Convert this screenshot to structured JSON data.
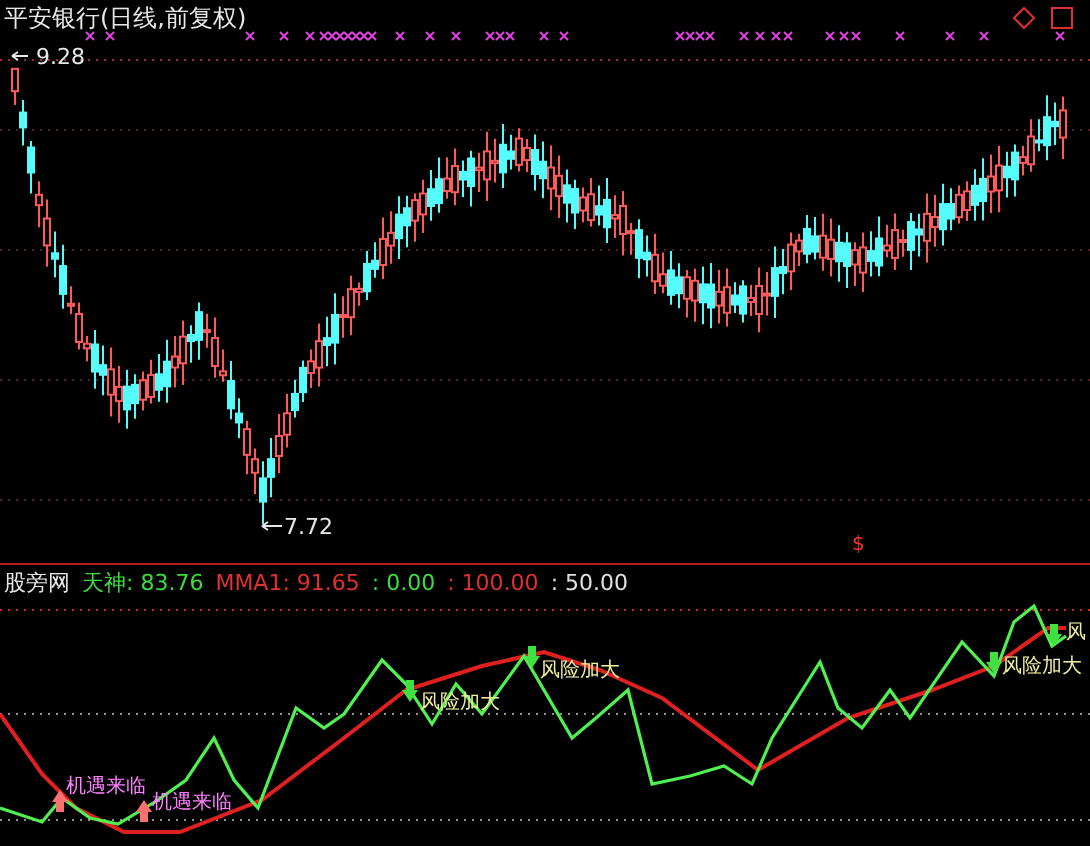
{
  "main_chart": {
    "title": "平安银行(日线,前复权)",
    "high_label": "9.28",
    "low_label": "7.72",
    "signal_symbol": "$"
  },
  "indicator": {
    "name": "股旁网",
    "values": [
      {
        "text": "天神: 83.76",
        "color": "#3cdc3c"
      },
      {
        "text": "MMA1: 91.65",
        "color": "#e03030"
      },
      {
        "text": ": 0.00",
        "color": "#3cdc3c"
      },
      {
        "text": ": 100.00",
        "color": "#e03030"
      },
      {
        "text": ": 50.00",
        "color": "#e0e0e0"
      }
    ]
  },
  "signals": [
    {
      "kind": "buy",
      "text": "机遇来临"
    },
    {
      "kind": "buy",
      "text": "机遇来临"
    },
    {
      "kind": "sell",
      "text": "风险加大"
    },
    {
      "kind": "sell",
      "text": "风险加大"
    },
    {
      "kind": "sell",
      "text": "风险加大"
    },
    {
      "kind": "sell",
      "text": "风"
    }
  ]
}
